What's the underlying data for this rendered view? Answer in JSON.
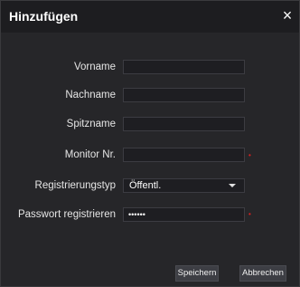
{
  "dialog": {
    "title": "Hinzufügen",
    "close_icon": "×"
  },
  "form": {
    "vorname": {
      "label": "Vorname",
      "value": ""
    },
    "nachname": {
      "label": "Nachname",
      "value": ""
    },
    "spitzname": {
      "label": "Spitzname",
      "value": ""
    },
    "monitor_nr": {
      "label": "Monitor Nr.",
      "value": "",
      "required_mark": "•"
    },
    "registrierungstyp": {
      "label": "Registrierungstyp",
      "selected": "Öffentl."
    },
    "passwort": {
      "label": "Passwort registrieren",
      "value": "••••••",
      "required_mark": "•"
    }
  },
  "buttons": {
    "save": "Speichern",
    "cancel": "Abbrechen"
  },
  "colors": {
    "background": "#262629",
    "titlebar": "#1d1d20",
    "field": "#1e1e22",
    "required": "#e02020",
    "button": "#3d3e44"
  }
}
